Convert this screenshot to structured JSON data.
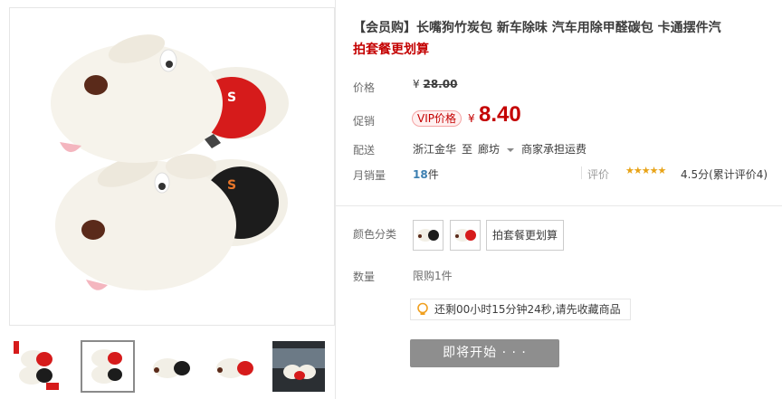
{
  "product": {
    "title": "【会员购】长嘴狗竹炭包 新车除味 汽车用除甲醛碳包 卡通摆件汽",
    "subtitle": "拍套餐更划算"
  },
  "labels": {
    "price": "价格",
    "promo": "促销",
    "shipping": "配送",
    "monthly_sales": "月销量",
    "rating": "评价",
    "color": "颜色分类",
    "quantity": "数量"
  },
  "price": {
    "currency": "¥",
    "original": "28.00",
    "vip_badge": "VIP价格",
    "promo": "8.40"
  },
  "shipping": {
    "from": "浙江金华",
    "to_word": "至",
    "to": "廊坊",
    "fee": "商家承担运费"
  },
  "sales": {
    "count": "18",
    "unit": "件"
  },
  "rating": {
    "stars_value": 4.5,
    "stars_glyphs": "★★★★★",
    "score_text": "4.5分(累计评价4)"
  },
  "options": {
    "color_text_option": "拍套餐更划算"
  },
  "quantity": {
    "limit": "限购1件"
  },
  "countdown": {
    "text": "还剩00小时15分钟24秒,请先收藏商品"
  },
  "buy_button": {
    "label": "即将开始 · · ·"
  },
  "colors": {
    "accent_red": "#c40000",
    "button_gray": "#8e8e8e",
    "link_blue": "#3c7fb1",
    "star_gold": "#e8a317"
  }
}
